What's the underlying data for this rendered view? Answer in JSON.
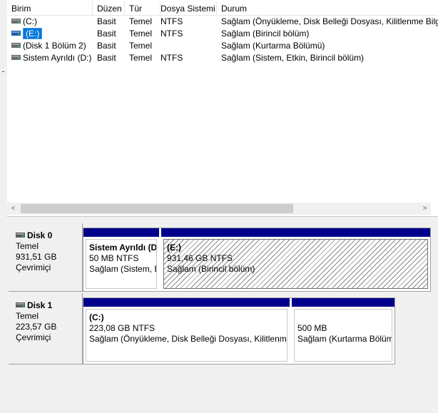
{
  "columns": [
    "Birim",
    "Düzen",
    "Tür",
    "Dosya Sistemi",
    "Durum"
  ],
  "volumes": [
    {
      "name": "(C:)",
      "layout": "Basit",
      "type": "Temel",
      "fs": "NTFS",
      "status": "Sağlam (Önyükleme, Disk Belleği Dosyası, Kilitlenme Bilg",
      "selected": false
    },
    {
      "name": "(E:)",
      "layout": "Basit",
      "type": "Temel",
      "fs": "NTFS",
      "status": "Sağlam (Birincil bölüm)",
      "selected": true
    },
    {
      "name": "(Disk 1 Bölüm 2)",
      "layout": "Basit",
      "type": "Temel",
      "fs": "",
      "status": "Sağlam (Kurtarma Bölümü)",
      "selected": false
    },
    {
      "name": "Sistem Ayrıldı (D:)",
      "layout": "Basit",
      "type": "Temel",
      "fs": "NTFS",
      "status": "Sağlam (Sistem, Etkin, Birincil bölüm)",
      "selected": false
    }
  ],
  "scrollbar": {
    "left_arrow": "<",
    "right_arrow": ">"
  },
  "disks": [
    {
      "name": "Disk 0",
      "type": "Temel",
      "size": "931,51 GB",
      "state": "Çevrimiçi",
      "partitions": [
        {
          "name": "Sistem Ayrıldı  (D",
          "size": "50 MB NTFS",
          "status": "Sağlam (Sistem, E"
        },
        {
          "name": "(E:)",
          "size": "931,46 GB NTFS",
          "status": "Sağlam (Birincil bölüm)"
        }
      ]
    },
    {
      "name": "Disk 1",
      "type": "Temel",
      "size": "223,57 GB",
      "state": "Çevrimiçi",
      "partitions": [
        {
          "name": "(C:)",
          "size": "223,08 GB NTFS",
          "status": "Sağlam (Önyükleme, Disk Belleği Dosyası, Kilitlenme"
        },
        {
          "name": "",
          "size": "500 MB",
          "status": "Sağlam (Kurtarma Bölüm"
        }
      ]
    }
  ],
  "colors": {
    "partition_bar": "#00008b",
    "selection": "#0078d7"
  },
  "icons": {
    "volume": "drive-icon",
    "disk": "disk-icon"
  }
}
